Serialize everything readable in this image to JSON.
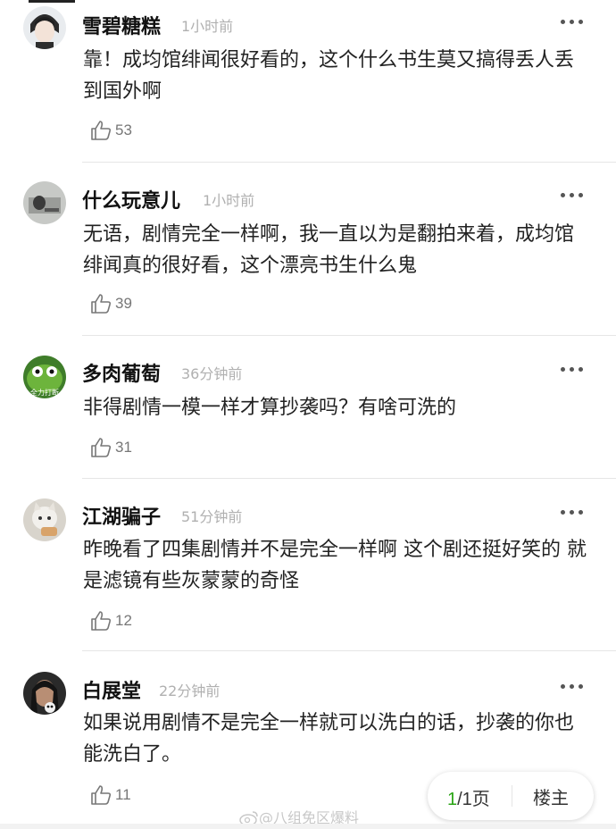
{
  "comments": [
    {
      "name": "雪碧糖糕",
      "time": "1小时前",
      "text": "靠！成均馆绯闻很好看的，这个什么书生莫又搞得丢人丢到国外啊",
      "likes": "53"
    },
    {
      "name": "什么玩意儿",
      "time": "1小时前",
      "text": "无语，剧情完全一样啊，我一直以为是翻拍来着，成均馆绯闻真的很好看，这个漂亮书生什么鬼",
      "likes": "39"
    },
    {
      "name": "多肉葡萄",
      "time": "36分钟前",
      "text": "非得剧情一模一样才算抄袭吗？有啥可洗的",
      "likes": "31",
      "avatar_text": "全力打断"
    },
    {
      "name": "江湖骗子",
      "time": "51分钟前",
      "text": "昨晚看了四集剧情并不是完全一样啊  这个剧还挺好笑的 就是滤镜有些灰蒙蒙的奇怪",
      "likes": "12"
    },
    {
      "name": "白展堂",
      "time": "22分钟前",
      "text": "如果说用剧情不是完全一样就可以洗白的话，抄袭的你也能洗白了。",
      "likes": "11"
    }
  ],
  "pager": {
    "current": "1",
    "total_suffix": "/1页",
    "owner_label": "楼主"
  },
  "watermark": "@八组免区爆料",
  "icons": {
    "like": "thumbs-up-icon",
    "more": "more-dots-icon",
    "weibo": "weibo-logo-icon"
  }
}
